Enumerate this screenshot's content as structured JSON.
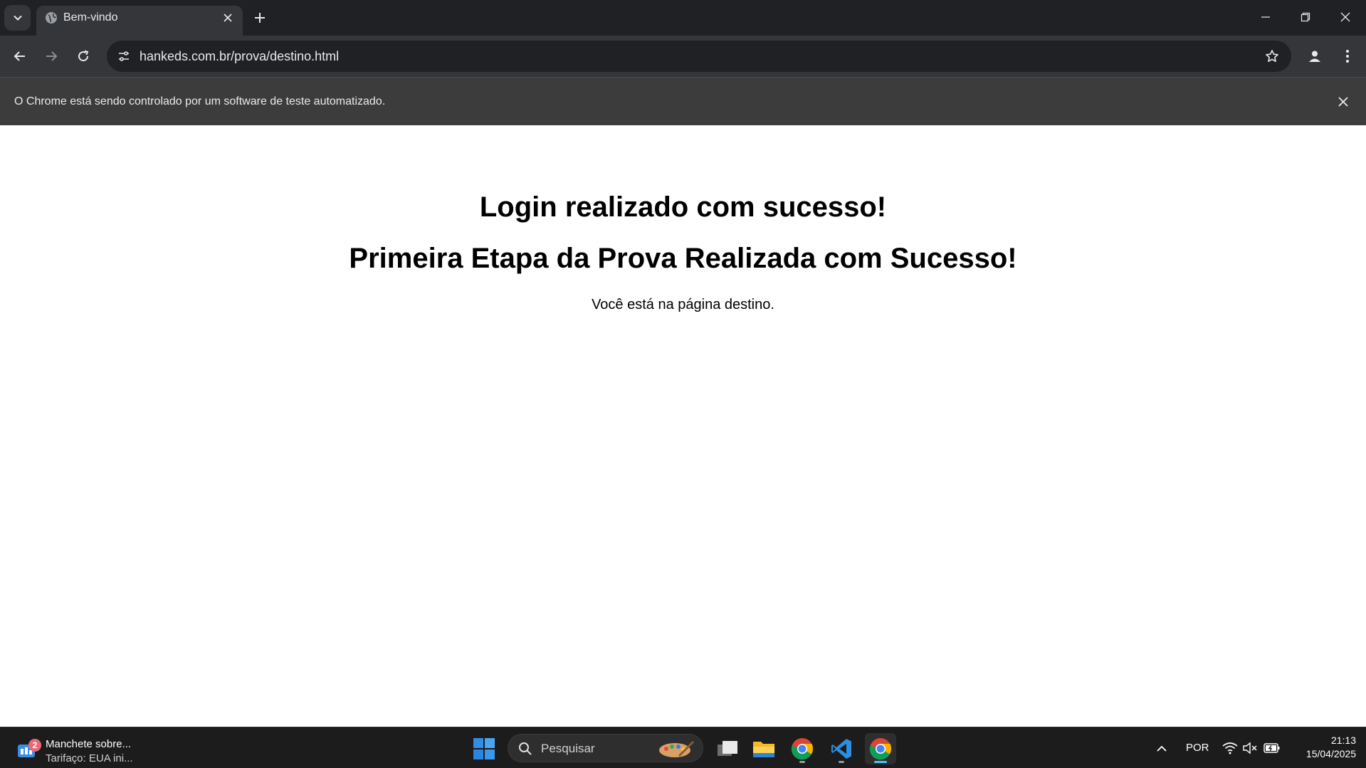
{
  "browser": {
    "tab_title": "Bem-vindo",
    "url": "hankeds.com.br/prova/destino.html",
    "infobar_text": "O Chrome está sendo controlado por um software de teste automatizado."
  },
  "page": {
    "heading1": "Login realizado com sucesso!",
    "heading2": "Primeira Etapa da Prova Realizada com Sucesso!",
    "paragraph": "Você está na página destino."
  },
  "taskbar": {
    "news_badge": "2",
    "news_title": "Manchete sobre...",
    "news_subtitle": "Tarifaço: EUA ini...",
    "search_placeholder": "Pesquisar",
    "language": "POR",
    "time": "21:13",
    "date": "15/04/2025",
    "pinned_apps": [
      "task-view-icon",
      "file-explorer-icon",
      "chrome-icon",
      "vscode-icon",
      "chrome-active-icon"
    ]
  },
  "colors": {
    "tabstrip": "#202124",
    "toolbar": "#35363a",
    "infobar": "#3c3c3c",
    "taskbar": "#1c1c1c",
    "windows_blue": "#2f8fe8"
  }
}
